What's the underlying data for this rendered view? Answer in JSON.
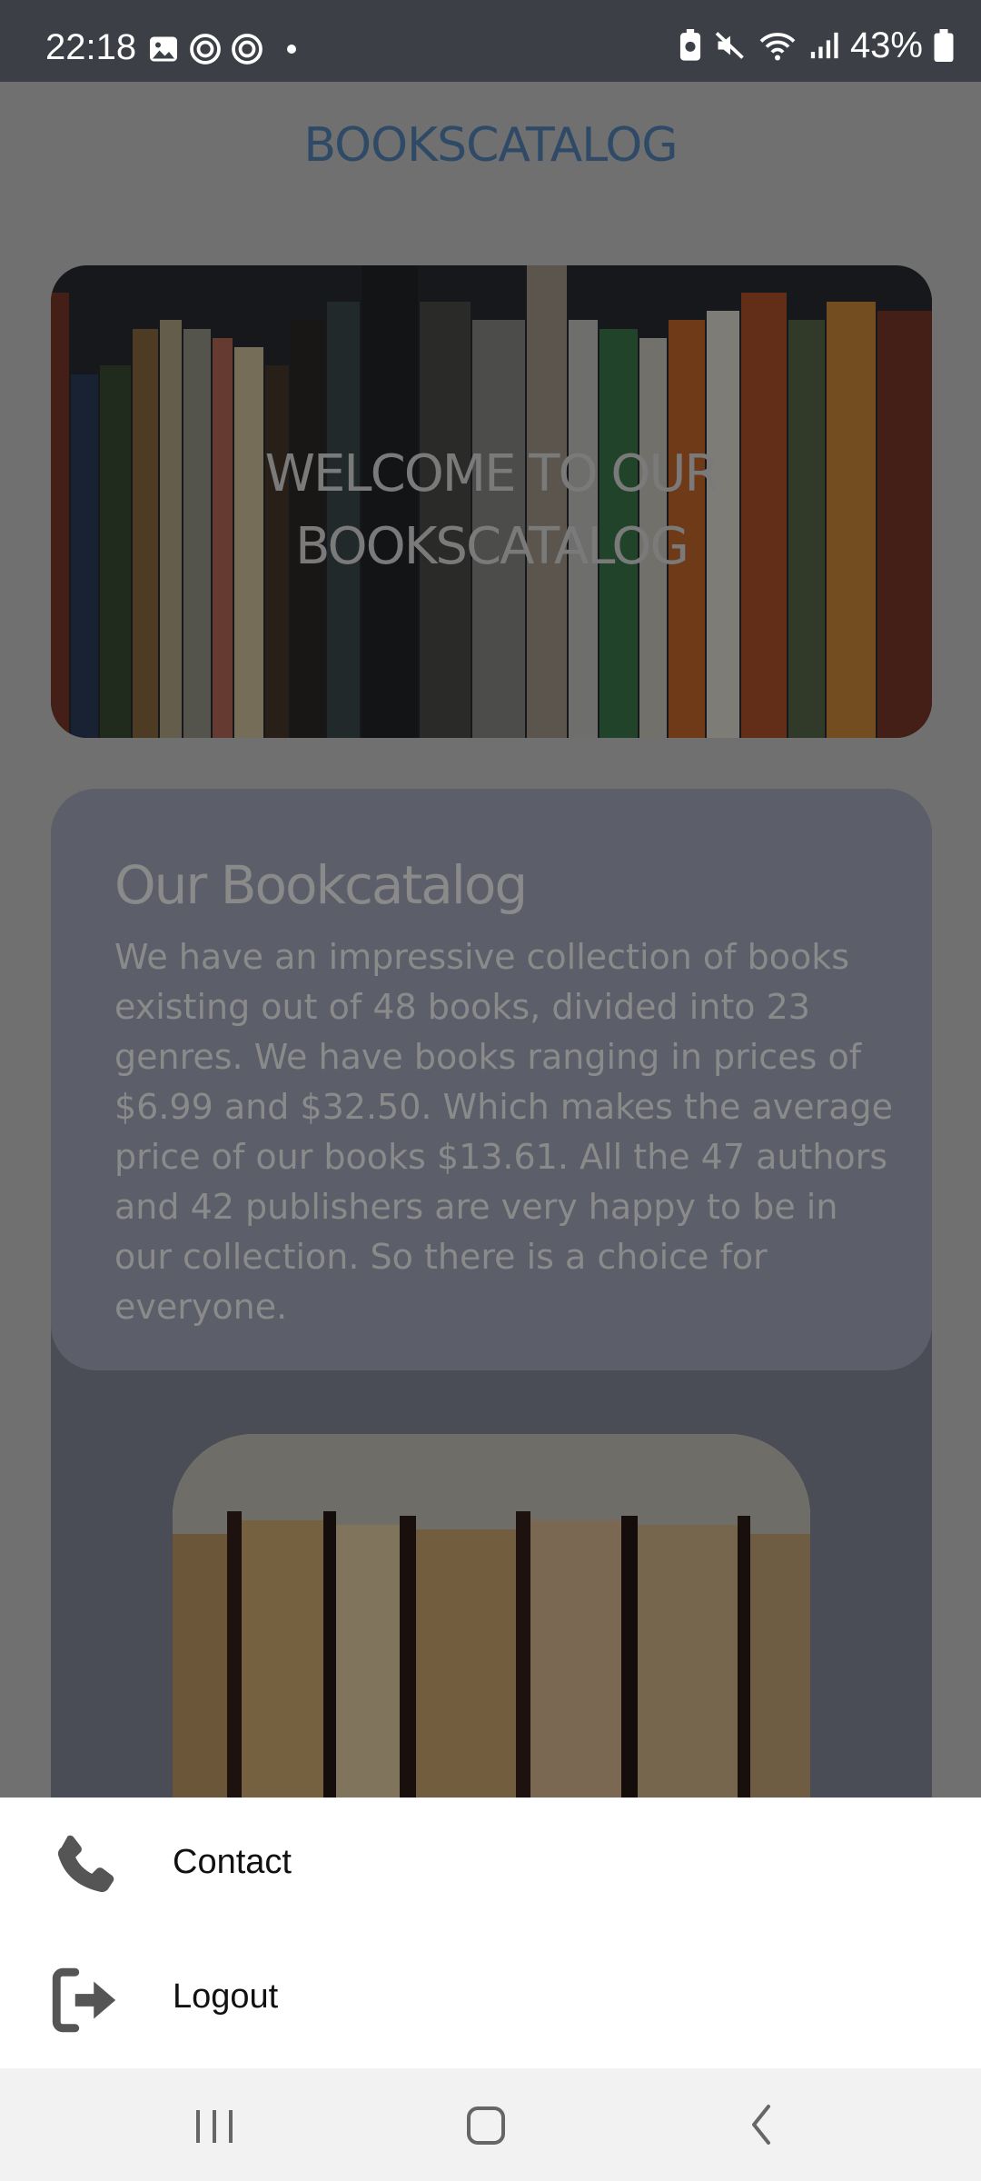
{
  "status_bar": {
    "time": "22:18",
    "battery": "43%",
    "icons": [
      "gallery-icon",
      "threads-icon",
      "threads-icon",
      "notification-dot",
      "battery-saver-icon",
      "mute-icon",
      "wifi-icon",
      "signal-icon",
      "battery-icon"
    ]
  },
  "app": {
    "title": "BOOKSCATALOG",
    "hero": {
      "line1": "WELCOME TO OUR",
      "line2": "BOOKSCATALOG"
    },
    "catalog_card": {
      "title": "Our Bookcatalog",
      "description": "We have an impressive collection of books existing out of 48 books, divided into 23 genres. We have books ranging in prices of $6.99 and $32.50. Which makes the average price of our books $13.61. All the 47 authors and 42 publishers are very happy to be in our collection. So there is a choice for everyone."
    }
  },
  "bottom_sheet": {
    "items": [
      {
        "label": "Contact",
        "icon": "phone-icon"
      },
      {
        "label": "Logout",
        "icon": "logout-icon"
      }
    ]
  },
  "nav_bar": {
    "buttons": [
      "recent-apps-icon",
      "home-icon",
      "back-icon"
    ]
  }
}
